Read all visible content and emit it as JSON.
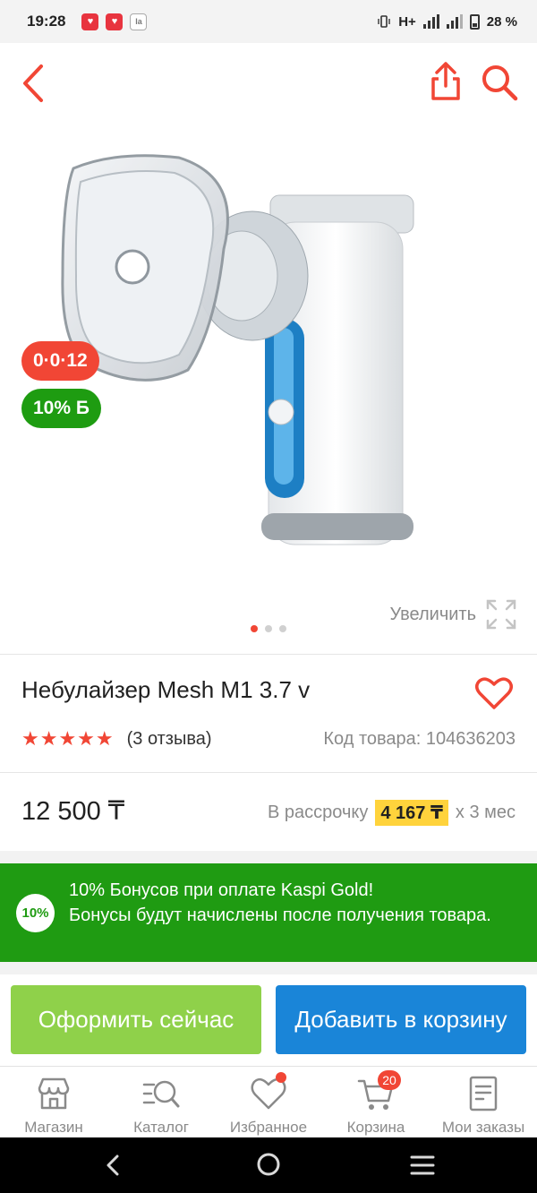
{
  "status_bar": {
    "time": "19:28",
    "network": "H+",
    "battery": "28 %"
  },
  "header": {
    "back_icon": "chevron-left-icon",
    "share_icon": "share-icon",
    "search_icon": "search-icon"
  },
  "gallery": {
    "timer_badge": "0·0·12",
    "bonus_badge": "10% Б",
    "zoom_label": "Увеличить",
    "pages": 3,
    "active_page": 1
  },
  "product": {
    "title": "Небулайзер Mesh M1 3.7 v",
    "stars": "★★★★★",
    "reviews": "(3 отзыва)",
    "code": "Код товара: 104636203",
    "price": "12 500 ₸",
    "installment_prefix": "В рассрочку",
    "installment_amount": "4 167 ₸",
    "installment_suffix": "x 3 мес"
  },
  "promo": {
    "circle": "10%",
    "line1": "10% Бонусов при оплате Kaspi Gold!",
    "line2": "Бонусы будут начислены после получения товара."
  },
  "actions": {
    "checkout": "Оформить сейчас",
    "add_to_cart": "Добавить в корзину"
  },
  "tabs": [
    {
      "label": "Магазин",
      "icon": "shop-icon"
    },
    {
      "label": "Каталог",
      "icon": "catalog-search-icon"
    },
    {
      "label": "Избранное",
      "icon": "heart-icon"
    },
    {
      "label": "Корзина",
      "icon": "cart-icon",
      "badge": "20"
    },
    {
      "label": "Мои заказы",
      "icon": "orders-icon"
    }
  ],
  "colors": {
    "accent_red": "#f14635",
    "bonus_green": "#1e9c11",
    "checkout_green": "#8fd14a",
    "cart_blue": "#1a85d8",
    "installment_yellow": "#ffd33c"
  }
}
